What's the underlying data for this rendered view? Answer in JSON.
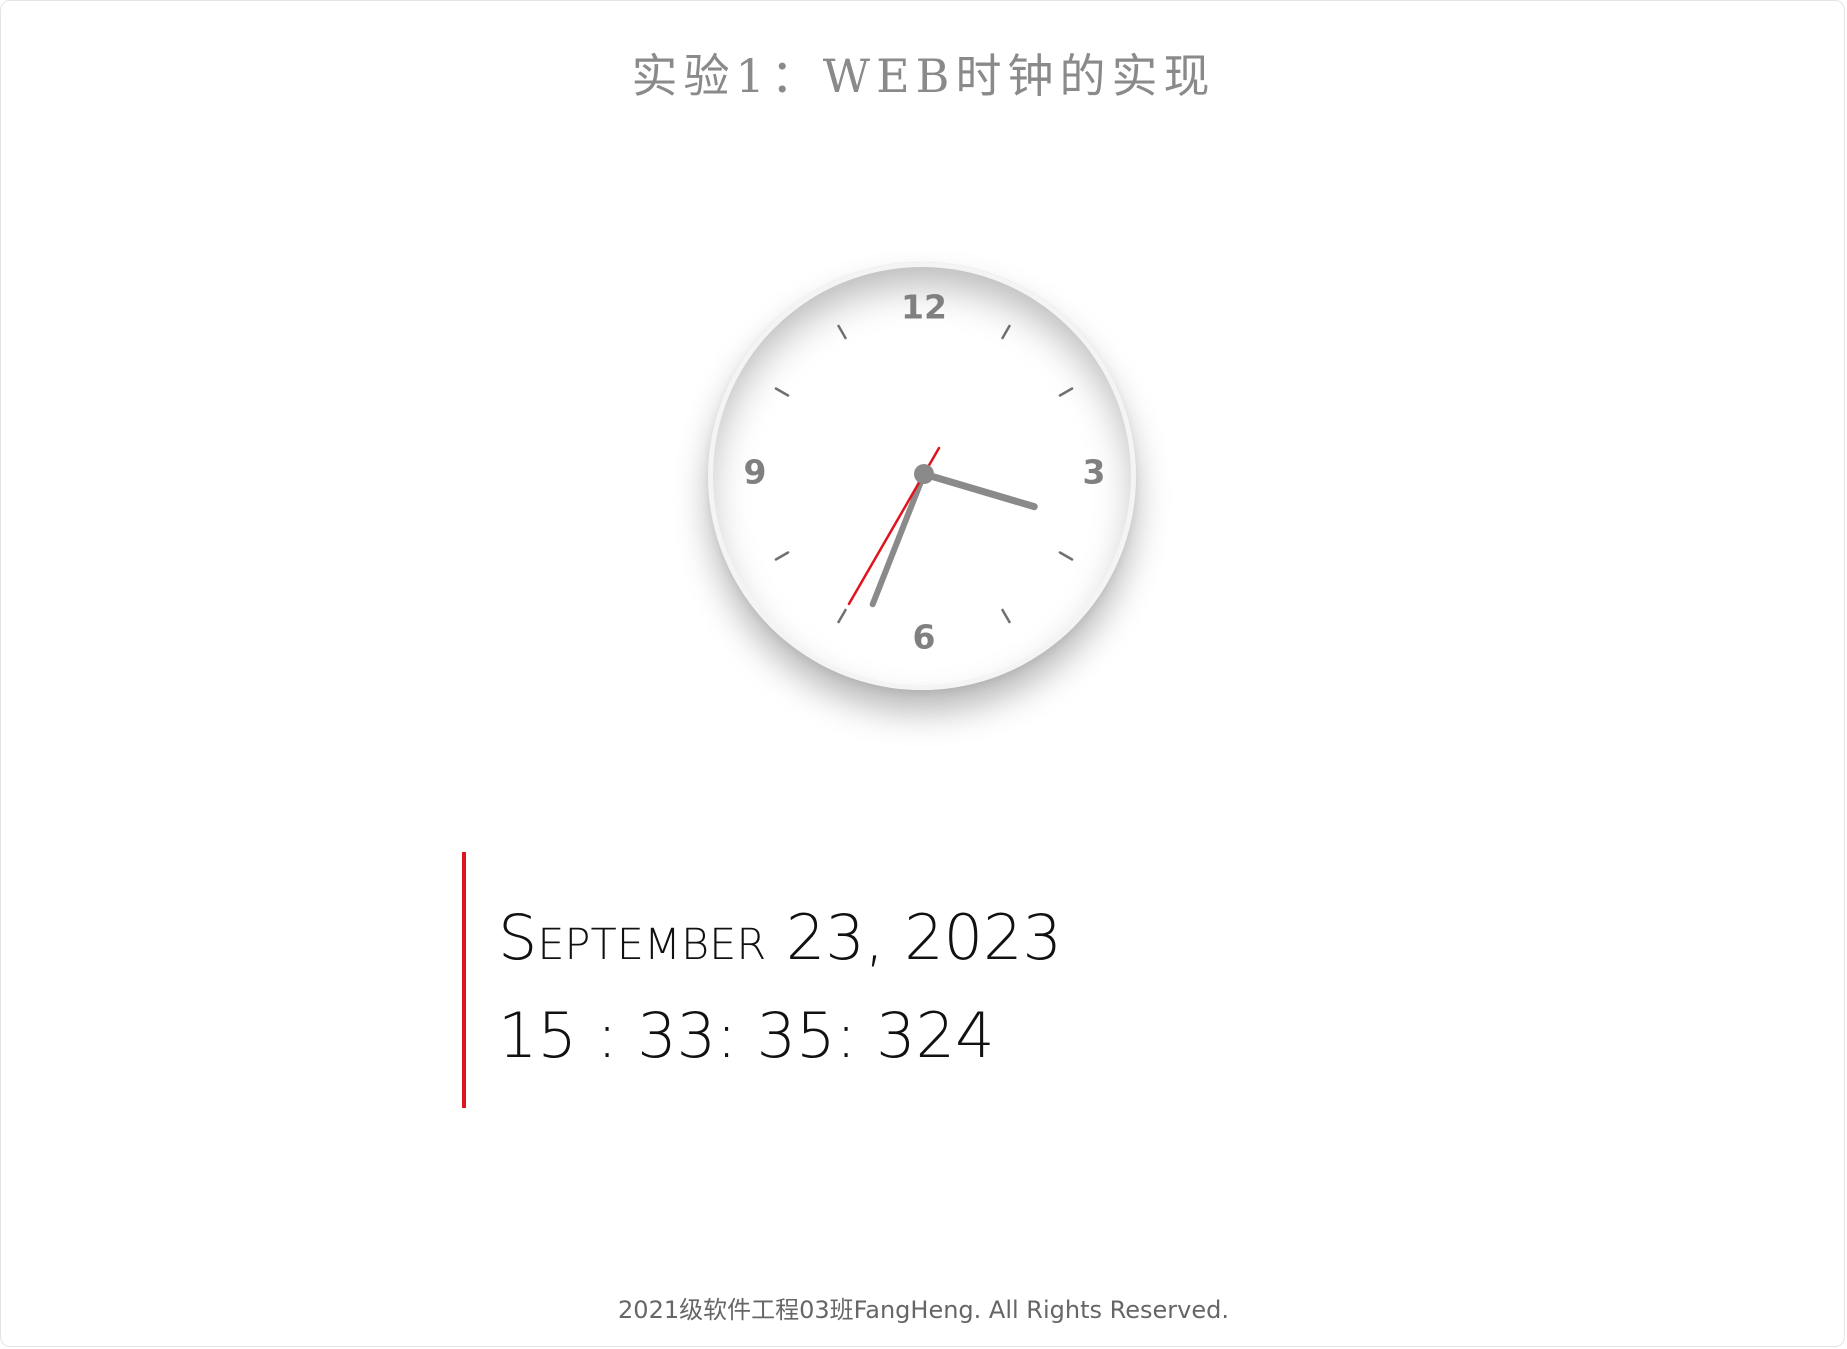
{
  "page": {
    "title": "实验1：WEB时钟的实现",
    "footer": "2021级软件工程03班FangHeng. All Rights Reserved."
  },
  "clock": {
    "numbers": {
      "twelve": "12",
      "three": "3",
      "six": "6",
      "nine": "9"
    },
    "time": {
      "hours": 15,
      "minutes": 33,
      "seconds": 35
    },
    "colors": {
      "hands": "#8a8a8a",
      "second_hand": "#e0141e",
      "ticks": "#707070",
      "numbers": "#808080"
    }
  },
  "datetime": {
    "date": "September 23, 2023",
    "time": "15 : 33: 35: 324",
    "accent_color": "#e0141e"
  }
}
